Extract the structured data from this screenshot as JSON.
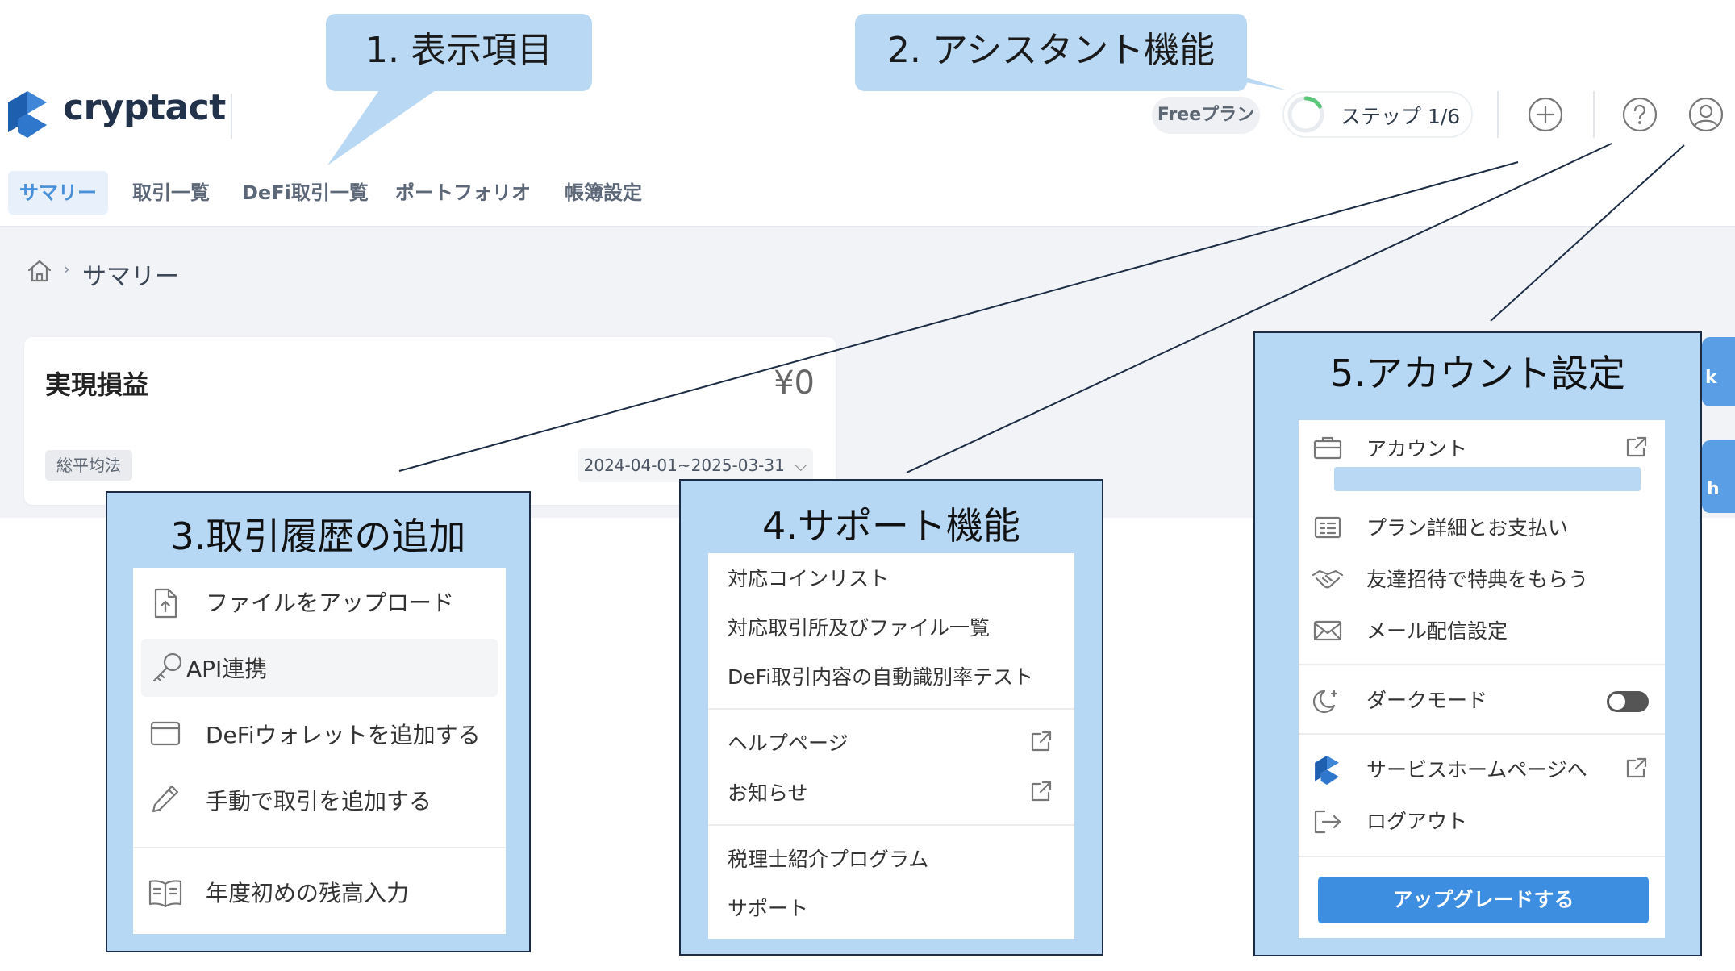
{
  "header": {
    "logo_text": "cryptact",
    "plan_label": "Freeプラン",
    "step_label": "ステップ 1/6",
    "step_progress": 0.1667,
    "icons": [
      "plus-circle-icon",
      "question-circle-icon",
      "user-circle-icon"
    ]
  },
  "nav": {
    "tabs": [
      {
        "label": "サマリー",
        "active": true
      },
      {
        "label": "取引一覧",
        "active": false
      },
      {
        "label": "DeFi取引一覧",
        "active": false
      },
      {
        "label": "ポートフォリオ",
        "active": false
      },
      {
        "label": "帳簿設定",
        "active": false
      }
    ]
  },
  "breadcrumb": {
    "current": "サマリー",
    "separator": "›"
  },
  "card": {
    "title": "実現損益",
    "amount": "¥0",
    "badge": "総平均法",
    "date_range": "2024-04-01~2025-03-31"
  },
  "edge_buttons": [
    "k",
    "h"
  ],
  "callouts": {
    "display_items": "1.  表示項目",
    "assistant": "2.  アシスタント機能",
    "add_history": {
      "title": "3.取引履歴の追加",
      "items": [
        "ファイルをアップロード",
        "API連携",
        "DeFiウォレットを追加する",
        "手動で取引を追加する",
        "年度初めの残高入力"
      ]
    },
    "support": {
      "title": "4.サポート機能",
      "items": [
        "対応コインリスト",
        "対応取引所及びファイル一覧",
        "DeFi取引内容の自動識別率テスト",
        "ヘルプページ",
        "お知らせ",
        "税理士紹介プログラム",
        "サポート"
      ]
    },
    "account": {
      "title": "5.アカウント設定",
      "items": [
        "アカウント",
        "プラン詳細とお支払い",
        "友達招待で特典をもらう",
        "メール配信設定",
        "ダークモード",
        "サービスホームページへ",
        "ログアウト"
      ],
      "dark_mode_on": false,
      "upgrade_button": "アップグレードする"
    }
  },
  "colors": {
    "accent": "#4a90d9",
    "callout_fill": "#b8d8f3",
    "upgrade_button": "#3d8ee0"
  }
}
